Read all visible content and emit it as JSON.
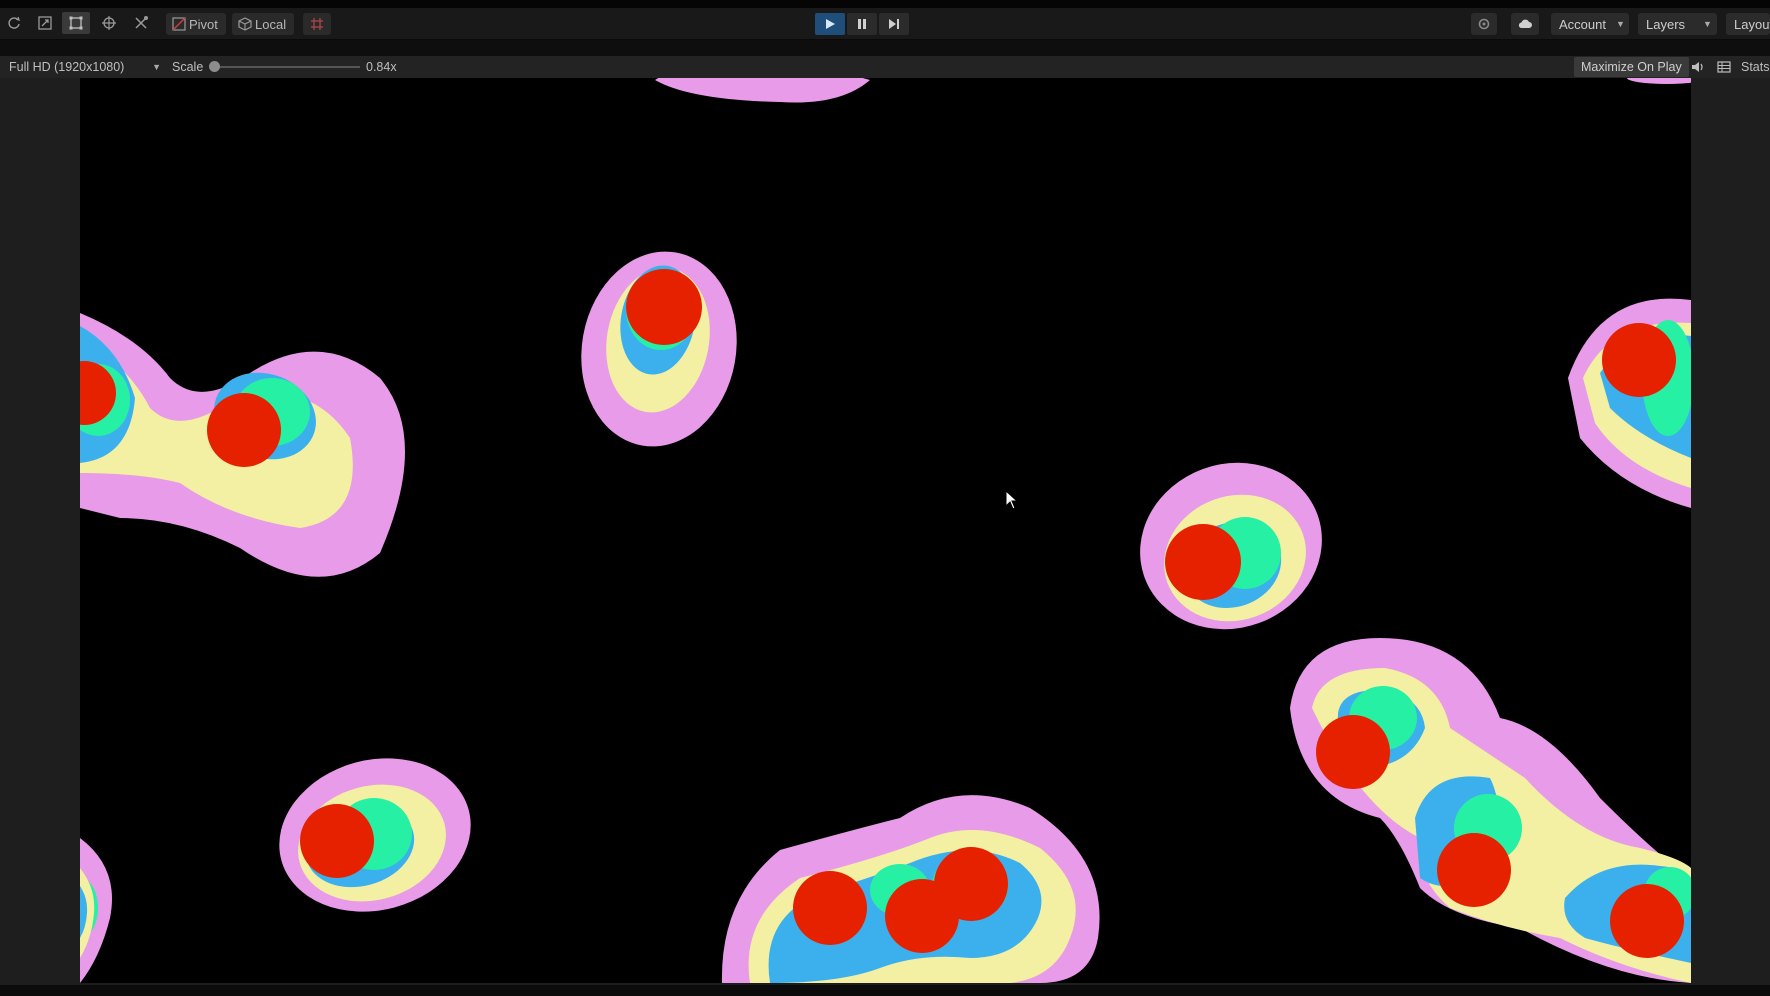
{
  "toolbar": {
    "pivot_label": "Pivot",
    "local_label": "Local",
    "account_label": "Account",
    "layers_label": "Layers",
    "layout_label": "Layout"
  },
  "gamebar": {
    "resolution_label": "Full HD (1920x1080)",
    "scale_label": "Scale",
    "scale_value": "0.84x",
    "maximize_label": "Maximize On Play",
    "stats_label": "Stats"
  },
  "colors": {
    "outer": "#e89be8",
    "yellow": "#f3f0a3",
    "blue": "#3cb0ec",
    "green": "#26f0a4",
    "core": "#e62100",
    "play_active": "#1f4e7a"
  },
  "icons": [
    "refresh-icon",
    "scale-icon",
    "rect-tool-icon",
    "transform-icon",
    "custom-tool-icon",
    "pivot-icon",
    "local-icon",
    "grid-snap-icon",
    "play-icon",
    "pause-icon",
    "step-icon",
    "settings-icon",
    "cloud-icon",
    "audio-icon",
    "stats-icon",
    "cursor-icon"
  ]
}
